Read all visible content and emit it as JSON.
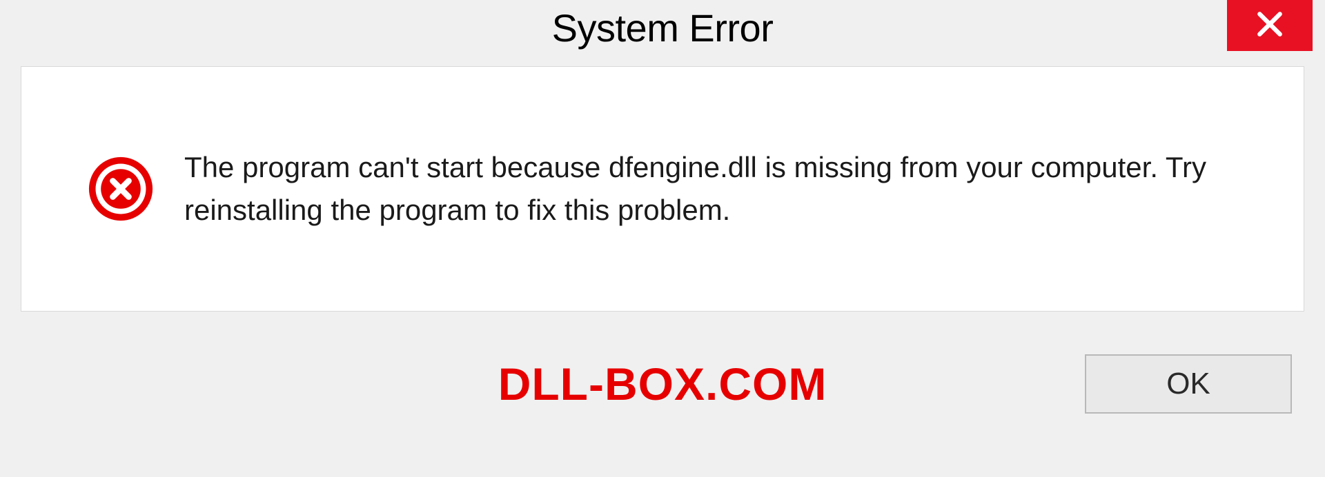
{
  "dialog": {
    "title": "System Error",
    "message": "The program can't start because dfengine.dll is missing from your computer. Try reinstalling the program to fix this problem.",
    "ok_label": "OK"
  },
  "watermark": "DLL-BOX.COM",
  "colors": {
    "close_bg": "#e81123",
    "error_icon": "#e60000",
    "watermark": "#e60000"
  }
}
